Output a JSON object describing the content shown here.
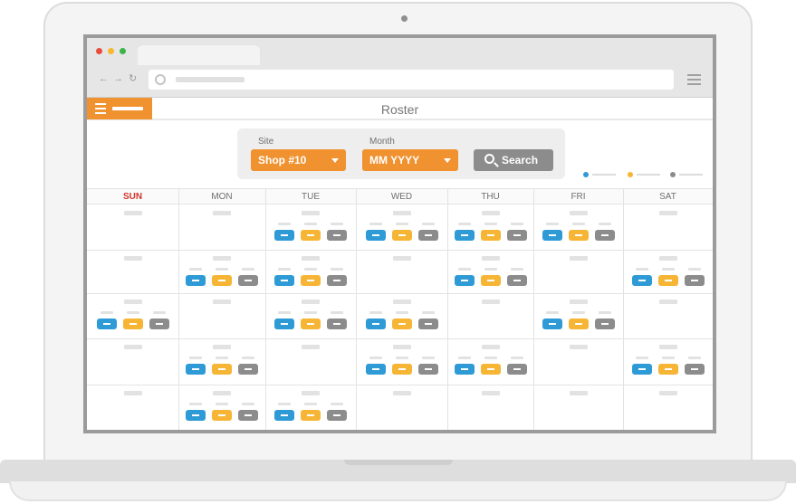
{
  "header": {
    "title": "Roster"
  },
  "filters": {
    "site": {
      "label": "Site",
      "value": "Shop #10"
    },
    "month": {
      "label": "Month",
      "value": "MM YYYY"
    },
    "search_label": "Search"
  },
  "colors": {
    "orange": "#f0922f",
    "blue": "#2f9bd6",
    "yellow": "#f6b534",
    "gray": "#8c8c8c",
    "sunday": "#d0342c"
  },
  "days": [
    "SUN",
    "MON",
    "TUE",
    "WED",
    "THU",
    "FRI",
    "SAT"
  ],
  "weeks": [
    [
      false,
      false,
      true,
      true,
      true,
      true,
      false
    ],
    [
      false,
      true,
      true,
      false,
      true,
      false,
      true
    ],
    [
      true,
      false,
      true,
      true,
      false,
      true,
      false
    ],
    [
      false,
      true,
      false,
      true,
      true,
      false,
      true
    ],
    [
      false,
      true,
      true,
      false,
      false,
      false,
      false
    ]
  ]
}
